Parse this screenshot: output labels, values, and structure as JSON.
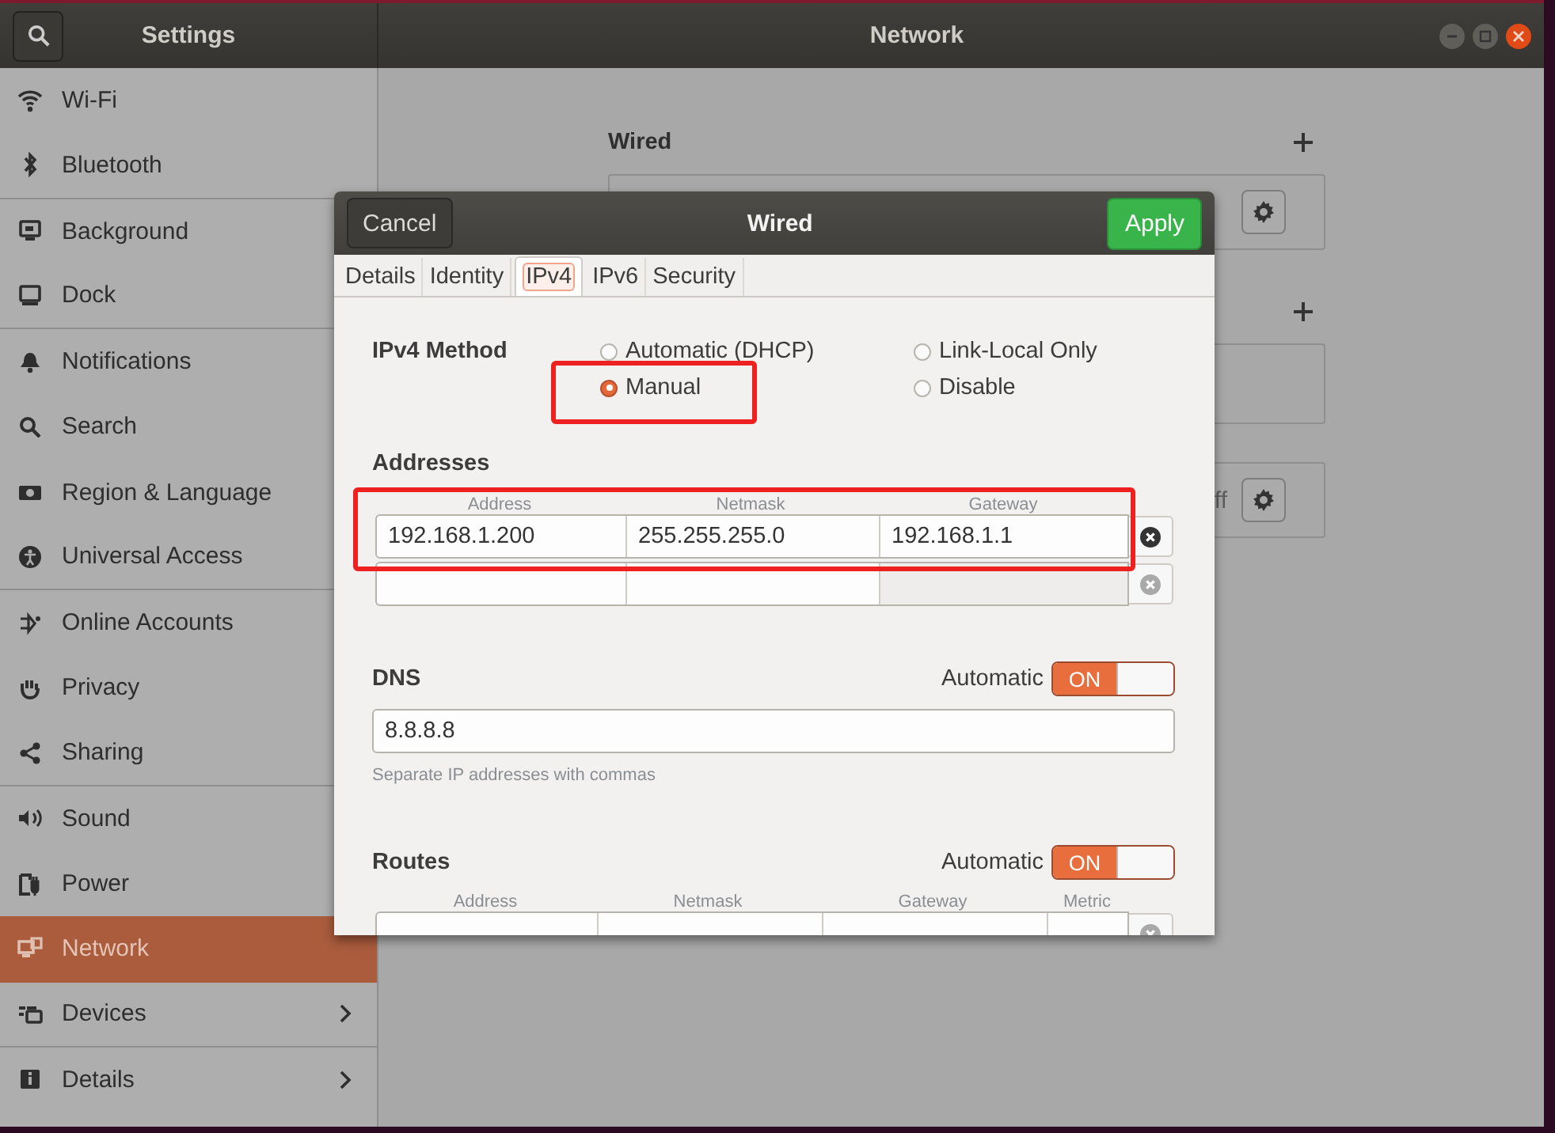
{
  "window": {
    "sidebar_title": "Settings",
    "title": "Network"
  },
  "sidebar": {
    "items": [
      {
        "label": "Wi-Fi",
        "selected": false,
        "group_end": false
      },
      {
        "label": "Bluetooth",
        "selected": false,
        "group_end": true
      },
      {
        "label": "Background",
        "selected": false,
        "group_end": false
      },
      {
        "label": "Dock",
        "selected": false,
        "group_end": true
      },
      {
        "label": "Notifications",
        "selected": false,
        "group_end": false
      },
      {
        "label": "Search",
        "selected": false,
        "group_end": false
      },
      {
        "label": "Region & Language",
        "selected": false,
        "group_end": false
      },
      {
        "label": "Universal Access",
        "selected": false,
        "group_end": true
      },
      {
        "label": "Online Accounts",
        "selected": false,
        "group_end": false
      },
      {
        "label": "Privacy",
        "selected": false,
        "group_end": false
      },
      {
        "label": "Sharing",
        "selected": false,
        "group_end": true
      },
      {
        "label": "Sound",
        "selected": false,
        "group_end": false
      },
      {
        "label": "Power",
        "selected": false,
        "group_end": false
      },
      {
        "label": "Network",
        "selected": true,
        "group_end": false
      },
      {
        "label": "Devices",
        "selected": false,
        "group_end": true,
        "has_arrow": true
      },
      {
        "label": "Details",
        "selected": false,
        "group_end": false,
        "has_arrow": true
      }
    ]
  },
  "panel": {
    "wired_title": "Wired",
    "status_fragment": "ff"
  },
  "dialog": {
    "title": "Wired",
    "cancel": "Cancel",
    "apply": "Apply",
    "tabs": [
      {
        "label": "Details",
        "selected": false
      },
      {
        "label": "Identity",
        "selected": false
      },
      {
        "label": "IPv4",
        "selected": true
      },
      {
        "label": "IPv6",
        "selected": false
      },
      {
        "label": "Security",
        "selected": false
      }
    ],
    "method_label": "IPv4 Method",
    "methods": [
      {
        "label": "Automatic (DHCP)",
        "selected": false
      },
      {
        "label": "Link-Local Only",
        "selected": false
      },
      {
        "label": "Manual",
        "selected": true,
        "highlighted": true
      },
      {
        "label": "Disable",
        "selected": false
      }
    ],
    "addresses": {
      "title": "Addresses",
      "highlighted": true,
      "columns": [
        "Address",
        "Netmask",
        "Gateway"
      ],
      "rows": [
        {
          "kind": "filled",
          "address": "192.168.1.200",
          "netmask": "255.255.255.0",
          "gateway": "192.168.1.1",
          "remove_disabled": false
        },
        {
          "kind": "blank",
          "remove_disabled": true
        }
      ]
    },
    "dns": {
      "title": "DNS",
      "automatic_label": "Automatic",
      "automatic": true,
      "toggle_text": "ON",
      "value": "8.8.8.8",
      "hint": "Separate IP addresses with commas"
    },
    "routes": {
      "title": "Routes",
      "automatic_label": "Automatic",
      "automatic": true,
      "toggle_text": "ON",
      "columns": [
        "Address",
        "Netmask",
        "Gateway",
        "Metric"
      ]
    }
  }
}
